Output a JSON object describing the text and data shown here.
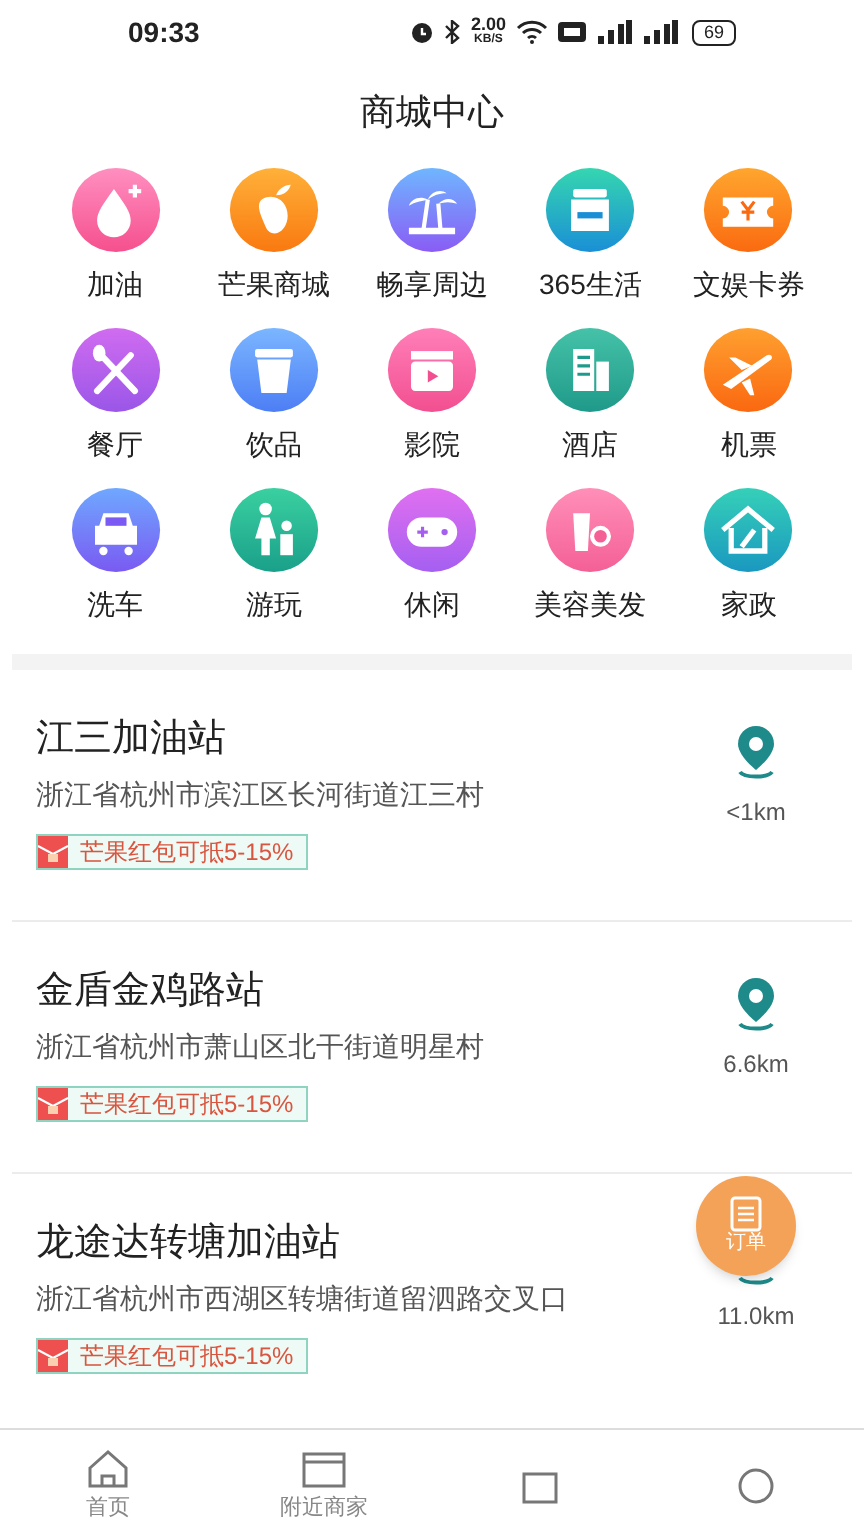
{
  "status_bar": {
    "time": "09:33",
    "speed": "2.00",
    "speed_unit": "KB/S",
    "battery": "69"
  },
  "title": "商城中心",
  "categories": [
    {
      "label": "加油"
    },
    {
      "label": "芒果商城"
    },
    {
      "label": "畅享周边"
    },
    {
      "label": "365生活"
    },
    {
      "label": "文娱卡券"
    },
    {
      "label": "餐厅"
    },
    {
      "label": "饮品"
    },
    {
      "label": "影院"
    },
    {
      "label": "酒店"
    },
    {
      "label": "机票"
    },
    {
      "label": "洗车"
    },
    {
      "label": "游玩"
    },
    {
      "label": "休闲"
    },
    {
      "label": "美容美发"
    },
    {
      "label": "家政"
    }
  ],
  "stations": [
    {
      "name": "江三加油站",
      "address": "浙江省杭州市滨江区长河街道江三村",
      "tag": "芒果红包可抵5-15%",
      "distance": "<1km"
    },
    {
      "name": "金盾金鸡路站",
      "address": "浙江省杭州市萧山区北干街道明星村",
      "tag": "芒果红包可抵5-15%",
      "distance": "6.6km"
    },
    {
      "name": "龙途达转塘加油站",
      "address": "浙江省杭州市西湖区转塘街道留泗路交叉口",
      "tag": "芒果红包可抵5-15%",
      "distance": "11.0km"
    }
  ],
  "order_button": {
    "label": "订单"
  },
  "tabs": [
    {
      "label": "首页",
      "selected": false
    },
    {
      "label": "附近商家",
      "selected": false
    },
    {
      "selected": false
    },
    {
      "selected": false
    }
  ]
}
